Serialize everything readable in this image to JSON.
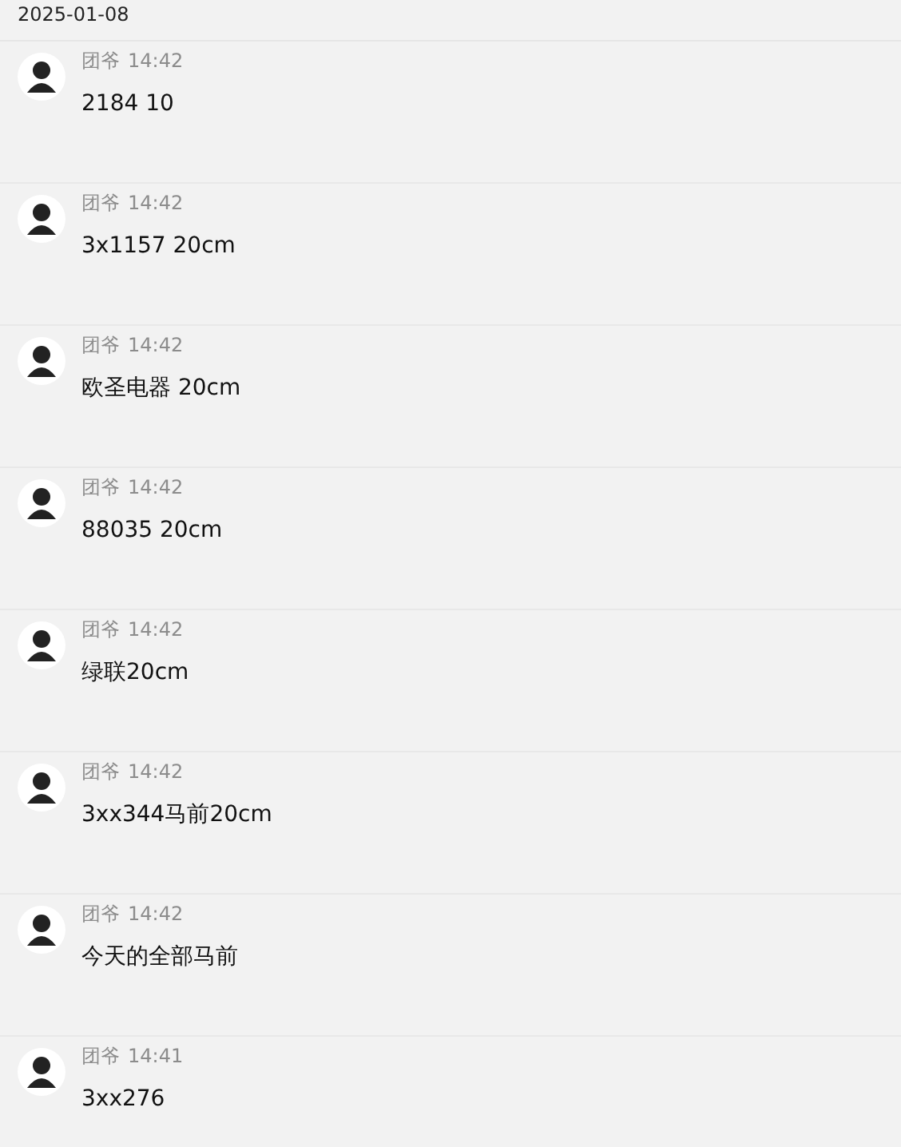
{
  "date": "2025-01-08",
  "messages": [
    {
      "sender": "团爷",
      "time": "14:42",
      "text": "2184 10"
    },
    {
      "sender": "团爷",
      "time": "14:42",
      "text": "3x1157 20cm"
    },
    {
      "sender": "团爷",
      "time": "14:42",
      "text": "欧圣电器 20cm"
    },
    {
      "sender": "团爷",
      "time": "14:42",
      "text": "88035 20cm"
    },
    {
      "sender": "团爷",
      "time": "14:42",
      "text": "绿联20cm"
    },
    {
      "sender": "团爷",
      "time": "14:42",
      "text": "3xx344马前20cm"
    },
    {
      "sender": "团爷",
      "time": "14:42",
      "text": "今天的全部马前"
    },
    {
      "sender": "团爷",
      "time": "14:41",
      "text": "3xx276"
    }
  ]
}
